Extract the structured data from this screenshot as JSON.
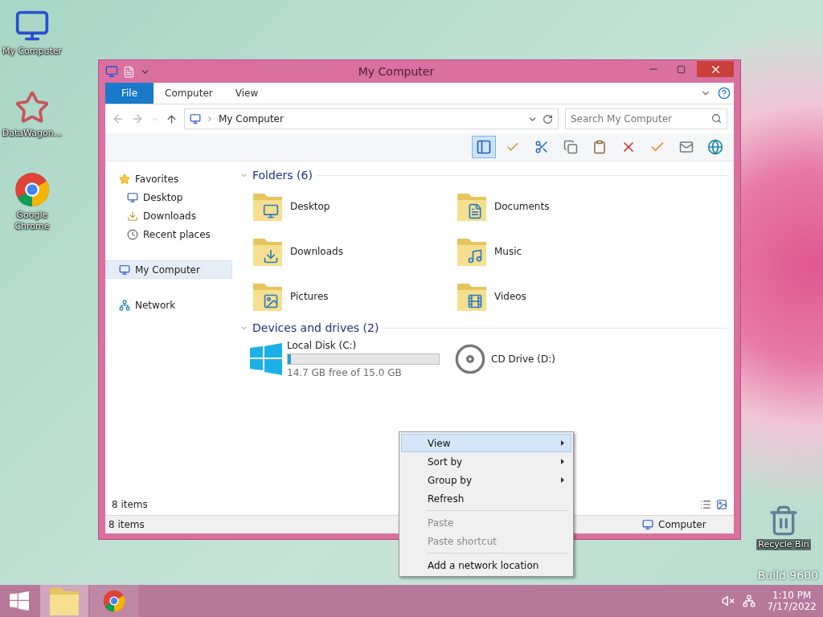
{
  "desktop_icons": [
    {
      "label": "My Computer",
      "kind": "computer"
    },
    {
      "label": "DataWagon...",
      "kind": "app"
    },
    {
      "label": "Google Chrome",
      "kind": "browser"
    },
    {
      "label": "Recycle Bin",
      "kind": "bin"
    }
  ],
  "watermark": "Build 9600",
  "window": {
    "title": "My Computer",
    "ribbon_tabs": [
      {
        "label": "File",
        "selected": true
      },
      {
        "label": "Computer",
        "selected": false
      },
      {
        "label": "View",
        "selected": false
      }
    ],
    "address": "My Computer",
    "search": {
      "placeholder": "Search My Computer"
    },
    "nav_pane": [
      {
        "label": "Favorites",
        "kind": "star",
        "selected": false,
        "children": [
          {
            "label": "Desktop",
            "kind": "desktop",
            "selected": false
          },
          {
            "label": "Downloads",
            "kind": "downloads",
            "selected": false
          },
          {
            "label": "Recent places",
            "kind": "recent",
            "selected": false
          }
        ]
      },
      {
        "label": "My Computer",
        "kind": "computer",
        "selected": true
      },
      {
        "label": "Network",
        "kind": "network",
        "selected": false
      }
    ],
    "groups": [
      {
        "title": "Folders (6)",
        "items": [
          {
            "name": "Desktop",
            "kind": "desktop"
          },
          {
            "name": "Documents",
            "kind": "documents"
          },
          {
            "name": "Downloads",
            "kind": "downloads"
          },
          {
            "name": "Music",
            "kind": "music"
          },
          {
            "name": "Pictures",
            "kind": "pictures"
          },
          {
            "name": "Videos",
            "kind": "videos"
          }
        ]
      },
      {
        "title": "Devices and drives (2)",
        "items": [
          {
            "name": "Local Disk (C:)",
            "kind": "disk",
            "level": 0.02,
            "free": "14.7 GB free of 15.0 GB"
          },
          {
            "name": "CD Drive (D:)",
            "kind": "cd"
          }
        ]
      }
    ],
    "item_count": "8 items",
    "status_bar": {
      "count": "8 items",
      "location": "Computer"
    }
  },
  "context_menu": [
    {
      "label": "View",
      "selected": true,
      "disabled": false,
      "submenu": true,
      "separator_before": false
    },
    {
      "label": "Sort by",
      "selected": false,
      "disabled": false,
      "submenu": true,
      "separator_before": false
    },
    {
      "label": "Group by",
      "selected": false,
      "disabled": false,
      "submenu": true,
      "separator_before": false
    },
    {
      "label": "Refresh",
      "selected": false,
      "disabled": false,
      "submenu": false,
      "separator_before": false
    },
    {
      "label": "Paste",
      "selected": false,
      "disabled": true,
      "submenu": false,
      "separator_before": true
    },
    {
      "label": "Paste shortcut",
      "selected": false,
      "disabled": true,
      "submenu": false,
      "separator_before": false
    },
    {
      "label": "Add a network location",
      "selected": false,
      "disabled": false,
      "submenu": false,
      "separator_before": true
    }
  ],
  "taskbar": {
    "apps": [
      {
        "kind": "explorer",
        "selected": true
      },
      {
        "kind": "browser",
        "selected": false
      }
    ],
    "time": "1:10 PM",
    "date": "7/17/2022"
  }
}
